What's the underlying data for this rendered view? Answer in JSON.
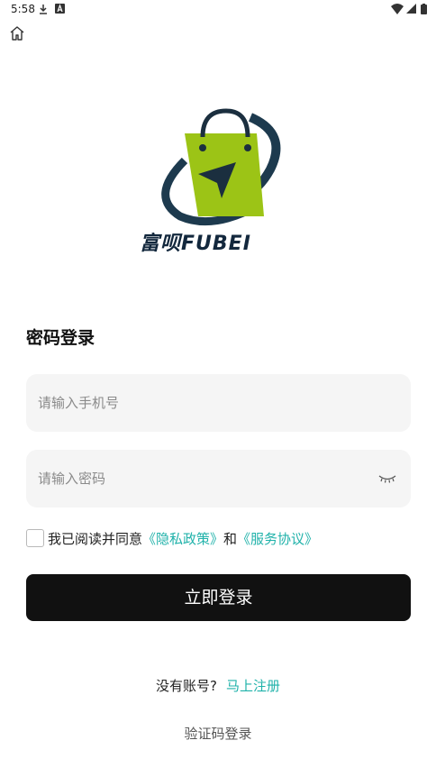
{
  "status_bar": {
    "time": "5:58",
    "icons": [
      "download-icon",
      "a-notification-icon",
      "wifi-icon",
      "signal-icon",
      "battery-icon"
    ]
  },
  "nav": {
    "home_icon": "home-icon"
  },
  "logo": {
    "text": "富呗FUBEI"
  },
  "login": {
    "title": "密码登录",
    "phone_placeholder": "请输入手机号",
    "password_placeholder": "请输入密码",
    "agree_prefix": "我已阅读并同意",
    "privacy_link": "《隐私政策》",
    "and": "和",
    "service_link": "《服务协议》",
    "submit_label": "立即登录",
    "no_account": "没有账号?",
    "register_link": "马上注册",
    "sms_login": "验证码登录"
  },
  "colors": {
    "accent": "#20b2aa",
    "button": "#111111",
    "field_bg": "#f5f5f5",
    "logo_green": "#9cc416",
    "logo_dark": "#13283d"
  }
}
